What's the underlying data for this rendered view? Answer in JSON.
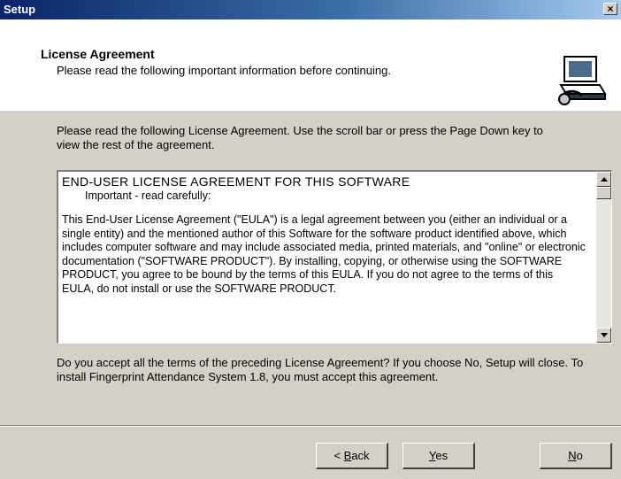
{
  "window": {
    "title": "Setup",
    "close_glyph": "×"
  },
  "header": {
    "title": "License Agreement",
    "subtitle": "Please read the following important information before continuing.",
    "icon": "computer-setup-icon"
  },
  "intro": "Please read the following License Agreement. Use the scroll bar or press the Page Down key to view the rest of the agreement.",
  "license": {
    "heading": "END-USER LICENSE AGREEMENT FOR THIS SOFTWARE",
    "subheading": "Important - read carefully:",
    "body": "This End-User License Agreement (\"EULA\") is a legal agreement between you (either an individual or a single entity) and the mentioned author of this Software for the software product identified above, which includes computer software and may include associated media, printed materials, and \"online\" or electronic documentation (\"SOFTWARE PRODUCT\"). By installing, copying, or otherwise using the SOFTWARE PRODUCT, you agree to be bound by the terms of this EULA. If you do not agree to the terms of this EULA, do not install or use the SOFTWARE PRODUCT."
  },
  "question": "Do you accept all the terms of the preceding License Agreement? If you choose No, Setup will close. To install Fingerprint Attendance System 1.8, you must accept this agreement.",
  "buttons": {
    "back_prefix": "< ",
    "back_mnemonic": "B",
    "back_rest": "ack",
    "yes_mnemonic": "Y",
    "yes_rest": "es",
    "no_mnemonic": "N",
    "no_rest": "o"
  }
}
